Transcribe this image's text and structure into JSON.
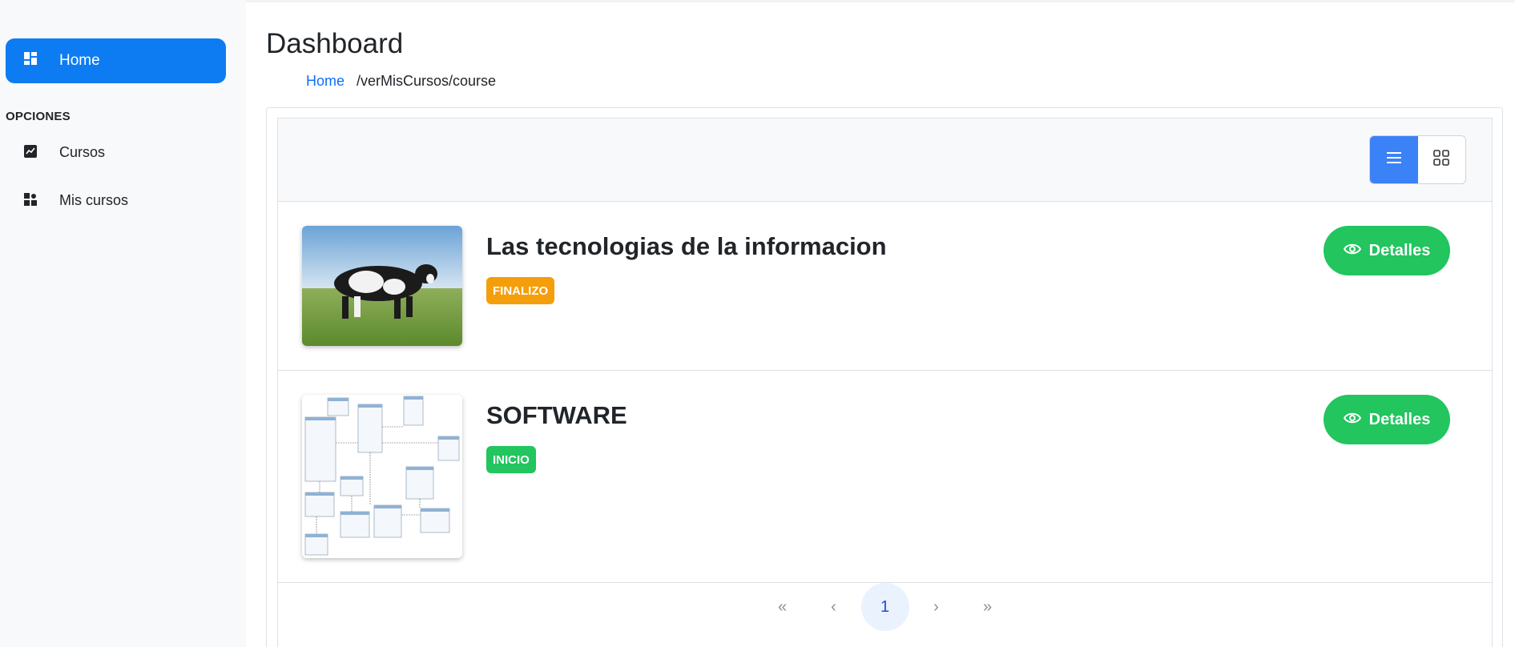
{
  "sidebar": {
    "home": {
      "label": "Home",
      "icon": "dashboard-icon"
    },
    "section_title": "OPCIONES",
    "items": [
      {
        "label": "Cursos",
        "icon": "chart-icon"
      },
      {
        "label": "Mis cursos",
        "icon": "grid-icon"
      }
    ]
  },
  "header": {
    "title": "Dashboard",
    "breadcrumb": {
      "home": "Home",
      "path": "/verMisCursos/course"
    }
  },
  "view_toggle": {
    "options": [
      "list-view",
      "grid-view"
    ],
    "active": "list-view"
  },
  "courses": [
    {
      "title": "Las tecnologias de la informacion",
      "status": "FINALIZO",
      "status_color": "#f59e0b",
      "thumbnail": "cow-in-field-image",
      "button_label": "Detalles"
    },
    {
      "title": "SOFTWARE",
      "status": "INICIO",
      "status_color": "#22c55e",
      "thumbnail": "database-diagram-image",
      "button_label": "Detalles"
    }
  ],
  "pagination": {
    "first": "«",
    "prev": "‹",
    "current": "1",
    "next": "›",
    "last": "»"
  },
  "colors": {
    "primary": "#0d7cf2",
    "success": "#22c55e",
    "warning": "#f59e0b",
    "toggle_active": "#3b82f6"
  }
}
